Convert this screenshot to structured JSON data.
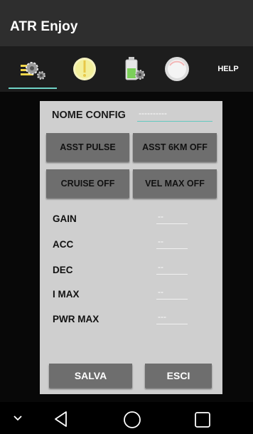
{
  "app": {
    "title": "ATR Enjoy"
  },
  "tabs": [
    {
      "icon": "settings-gears-icon",
      "active": true
    },
    {
      "icon": "warning-bulb-icon",
      "active": false
    },
    {
      "icon": "battery-settings-icon",
      "active": false
    },
    {
      "icon": "speedometer-icon",
      "active": false
    },
    {
      "label": "HELP"
    }
  ],
  "config": {
    "name_label": "NOME CONFIG",
    "name_value": "----------"
  },
  "buttons": {
    "asst_pulse": "ASST PULSE",
    "asst_6km": "ASST 6KM OFF",
    "cruise": "CRUISE OFF",
    "vel_max": "VEL MAX OFF"
  },
  "params": [
    {
      "label": "GAIN",
      "value": "--"
    },
    {
      "label": "ACC",
      "value": "--"
    },
    {
      "label": "DEC",
      "value": "--"
    },
    {
      "label": "I MAX",
      "value": "--"
    },
    {
      "label": "PWR MAX",
      "value": "---"
    }
  ],
  "footer": {
    "save": "SALVA",
    "exit": "ESCI"
  },
  "colors": {
    "accent": "#6fd3c6",
    "button": "#6e6e6e",
    "panel": "#cfcfcf",
    "appbar": "#2e2e2e"
  }
}
